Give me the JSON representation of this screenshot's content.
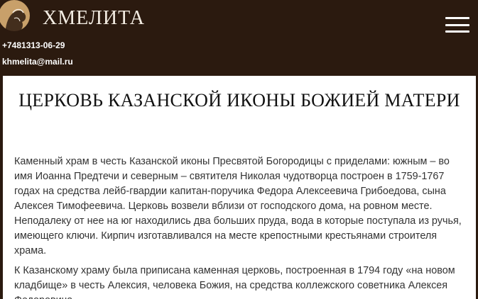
{
  "header": {
    "logo_text": "ХМЕЛИТА",
    "phone": "+7481313-06-29",
    "email": "khmelita@mail.ru",
    "menu_icon": "hamburger-menu-icon",
    "logo_icon": "portrait-logo-icon"
  },
  "main": {
    "title": "ЦЕРКОВЬ КАЗАНСКОЙ ИКОНЫ БОЖИЕЙ МАТЕРИ",
    "paragraphs": [
      "Каменный храм в честь Казанской иконы Пресвятой Богородицы с приделами: южным – во имя Иоанна Предтечи и северным – святителя Николая чудотворца построен в 1759-1767 годах на средства лейб-гвардии капитан-поручика Федора Алексеевича Грибоедова, сына Алексея Тимофеевича. Церковь возвели вблизи от господского дома, на ровном месте. Неподалеку от нее на юг находились два больших пруда, вода в которые поступала из ручья, имеющего ключи. Кирпич изготавливался на месте крепостными крестьянами строителя храма.",
      "К Казанскому храму была приписана каменная церковь, построенная в 1794 году «на новом кладбище» в честь Алексия, человека Божия, на средства коллежского советника Алексея Федоровича"
    ]
  },
  "colors": {
    "header_bg": "#2b1a0f",
    "logo_gold": "#c8a06a",
    "text": "#333333"
  }
}
